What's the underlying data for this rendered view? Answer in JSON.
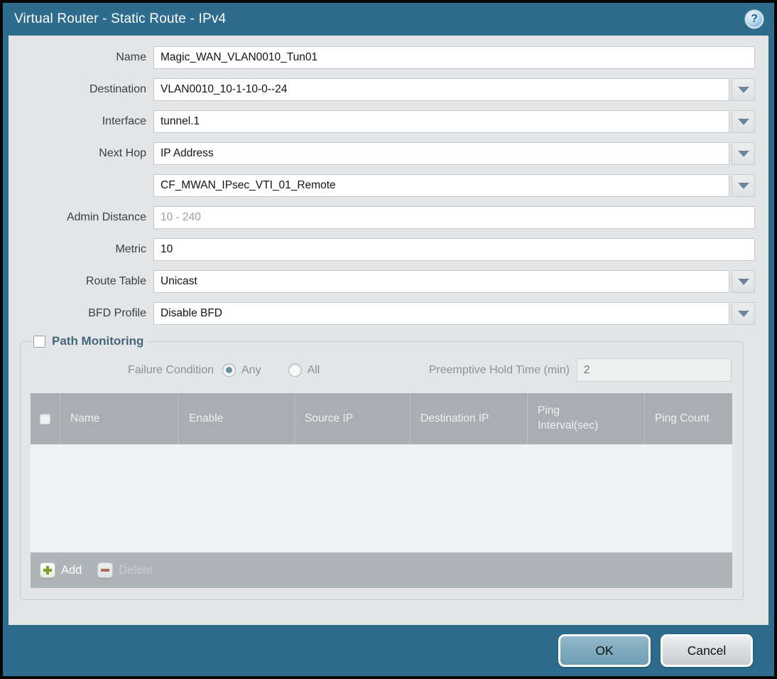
{
  "window": {
    "title": "Virtual Router - Static Route - IPv4",
    "help_glyph": "?"
  },
  "form": {
    "name": {
      "label": "Name",
      "value": "Magic_WAN_VLAN0010_Tun01"
    },
    "destination": {
      "label": "Destination",
      "value": "VLAN0010_10-1-10-0--24"
    },
    "interface": {
      "label": "Interface",
      "value": "tunnel.1"
    },
    "next_hop": {
      "label": "Next Hop",
      "value": "IP Address"
    },
    "next_hop_address": {
      "value": "CF_MWAN_IPsec_VTI_01_Remote"
    },
    "admin_distance": {
      "label": "Admin Distance",
      "value": "",
      "placeholder": "10 - 240"
    },
    "metric": {
      "label": "Metric",
      "value": "10"
    },
    "route_table": {
      "label": "Route Table",
      "value": "Unicast"
    },
    "bfd_profile": {
      "label": "BFD Profile",
      "value": "Disable BFD"
    }
  },
  "path_monitoring": {
    "title": "Path Monitoring",
    "enabled": false,
    "failure_condition": {
      "label": "Failure Condition",
      "options": [
        {
          "label": "Any",
          "selected": true
        },
        {
          "label": "All",
          "selected": false
        }
      ]
    },
    "preemptive_hold_time": {
      "label": "Preemptive Hold Time (min)",
      "value": "2"
    },
    "table": {
      "columns": [
        "Name",
        "Enable",
        "Source IP",
        "Destination IP",
        "Ping Interval(sec)",
        "Ping Count"
      ],
      "rows": []
    },
    "toolbar": {
      "add": "Add",
      "delete": "Delete"
    }
  },
  "footer": {
    "ok": "OK",
    "cancel": "Cancel"
  },
  "colors": {
    "frame_teal": "#2d6c8c",
    "body_gray": "#e3e5e6",
    "table_header_gray": "#a8aeb2",
    "ok_button_blue": "#7da9bc",
    "add_icon_green": "#7aa231",
    "delete_icon_red": "#b0685c",
    "dropdown_arrow": "#6f8599"
  }
}
